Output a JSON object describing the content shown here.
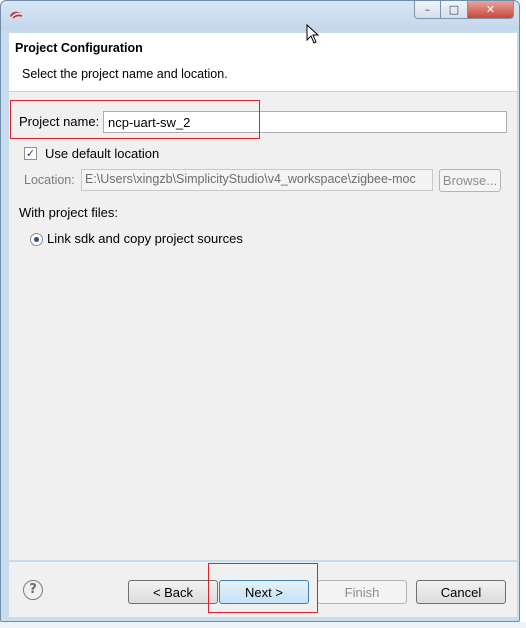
{
  "window": {
    "icon": "simplicity-studio-logo-icon",
    "controls": {
      "minimize": "–",
      "maximize": "□",
      "close": "✕"
    }
  },
  "header": {
    "title": "Project Configuration",
    "description": "Select the project name and location."
  },
  "form": {
    "project_name_label": "Project name:",
    "project_name_value": "ncp-uart-sw_2",
    "use_default_label": "Use default location",
    "use_default_checked": true,
    "location_label": "Location:",
    "location_value": "E:\\Users\\xingzb\\SimplicityStudio\\v4_workspace\\zigbee-moc",
    "browse_label": "Browse...",
    "project_files_label": "With project files:",
    "radio_option_label": "Link sdk and copy project sources",
    "radio_selected": true
  },
  "footer": {
    "help": "?",
    "back_label": "< Back",
    "next_label": "Next >",
    "finish_label": "Finish",
    "cancel_label": "Cancel"
  },
  "colors": {
    "highlight": "#e0202a",
    "window_frame": "#c8dcef"
  }
}
